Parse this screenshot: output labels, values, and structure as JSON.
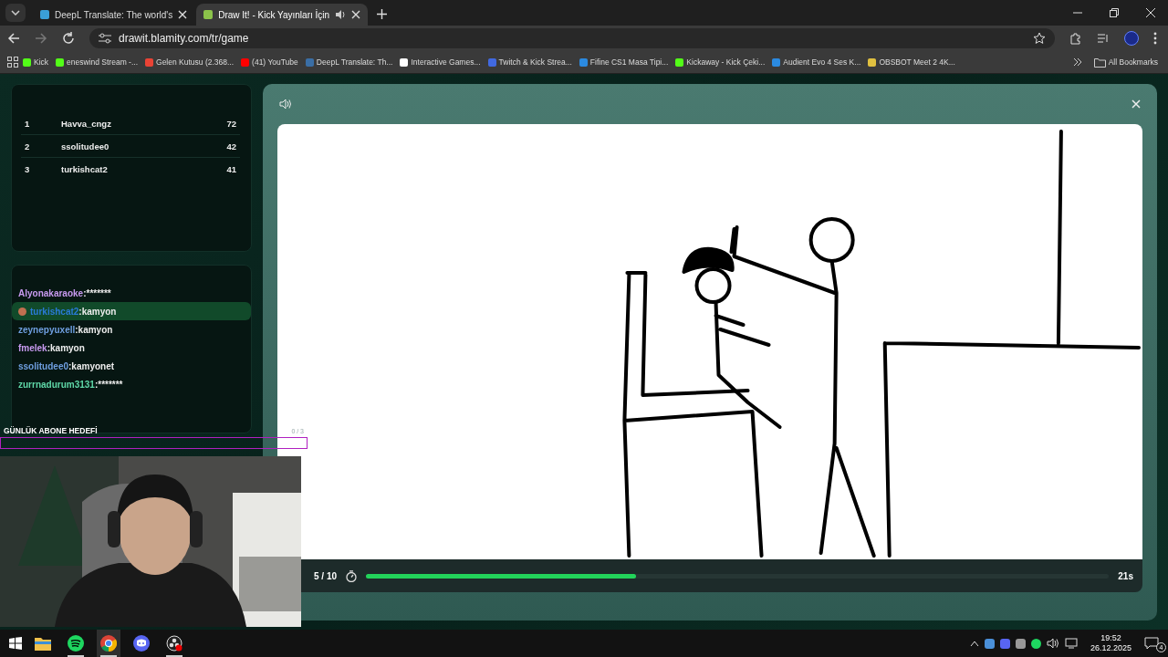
{
  "browser": {
    "tabs": [
      {
        "title": "DeepL Translate: The world's",
        "selected": false,
        "audio": false,
        "color": "#3a9fd8"
      },
      {
        "title": "Draw It! - Kick Yayınları İçin",
        "selected": true,
        "audio": true,
        "color": "#8bc34a"
      }
    ],
    "url": "drawit.blamity.com/tr/game",
    "bookmarks": [
      {
        "label": "Kick",
        "color": "#53fc18"
      },
      {
        "label": "eneswind Stream -...",
        "color": "#53fc18"
      },
      {
        "label": "Gelen Kutusu (2.368...",
        "color": "#ea4335"
      },
      {
        "label": "(41) YouTube",
        "color": "#ff0000"
      },
      {
        "label": "DeepL Translate: Th...",
        "color": "#3a6ea5"
      },
      {
        "label": "Interactive Games...",
        "color": "#ffffff"
      },
      {
        "label": "Twitch & Kick Strea...",
        "color": "#4169e1"
      },
      {
        "label": "Fifine CS1 Masa Tipi...",
        "color": "#2b8ae0"
      },
      {
        "label": "Kickaway - Kick Çeki...",
        "color": "#53fc18"
      },
      {
        "label": "Audient Evo 4 Ses K...",
        "color": "#2b8ae0"
      },
      {
        "label": "OBSBOT Meet 2 4K...",
        "color": "#e0c040"
      }
    ],
    "all_bookmarks": "All Bookmarks"
  },
  "leaderboard": [
    {
      "rank": "1",
      "name": "Havva_cngz",
      "score": "72"
    },
    {
      "rank": "2",
      "name": "ssolitudee0",
      "score": "42"
    },
    {
      "rank": "3",
      "name": "turkishcat2",
      "score": "41"
    }
  ],
  "chat": [
    {
      "user": "Alyonakaraoke",
      "message": ":*******",
      "color": "#c89af0",
      "highlighted": false
    },
    {
      "user": "turkishcat2",
      "message": ":kamyon",
      "color": "#2a7ad8",
      "highlighted": true
    },
    {
      "user": "zeynepyuxell",
      "message": ":kamyon",
      "color": "#6f9fe0",
      "highlighted": false
    },
    {
      "user": "fmelek",
      "message": ":kamyon",
      "color": "#c89af0",
      "highlighted": false
    },
    {
      "user": "ssolitudee0",
      "message": ":kamyonet",
      "color": "#6f9fe0",
      "highlighted": false
    },
    {
      "user": "zurrnadurum3131",
      "message": ":*******",
      "color": "#5fd8a8",
      "highlighted": false
    }
  ],
  "sub_goal": {
    "title": "GÜNLÜK ABONE HEDEFİ",
    "count": "0 / 3"
  },
  "game": {
    "round": "5 / 10",
    "timer": {
      "level": 0.364
    },
    "seconds": "21s"
  },
  "taskbar": {
    "apps": [
      {
        "kind": "explorer",
        "running": false,
        "selected": false
      },
      {
        "kind": "spotify",
        "running": true,
        "selected": false
      },
      {
        "kind": "chrome",
        "running": true,
        "selected": true
      },
      {
        "kind": "discord",
        "running": false,
        "selected": false
      },
      {
        "kind": "obs",
        "running": true,
        "selected": false
      }
    ],
    "time": "19:52",
    "date": "26.12.2025",
    "notifications": "4"
  }
}
